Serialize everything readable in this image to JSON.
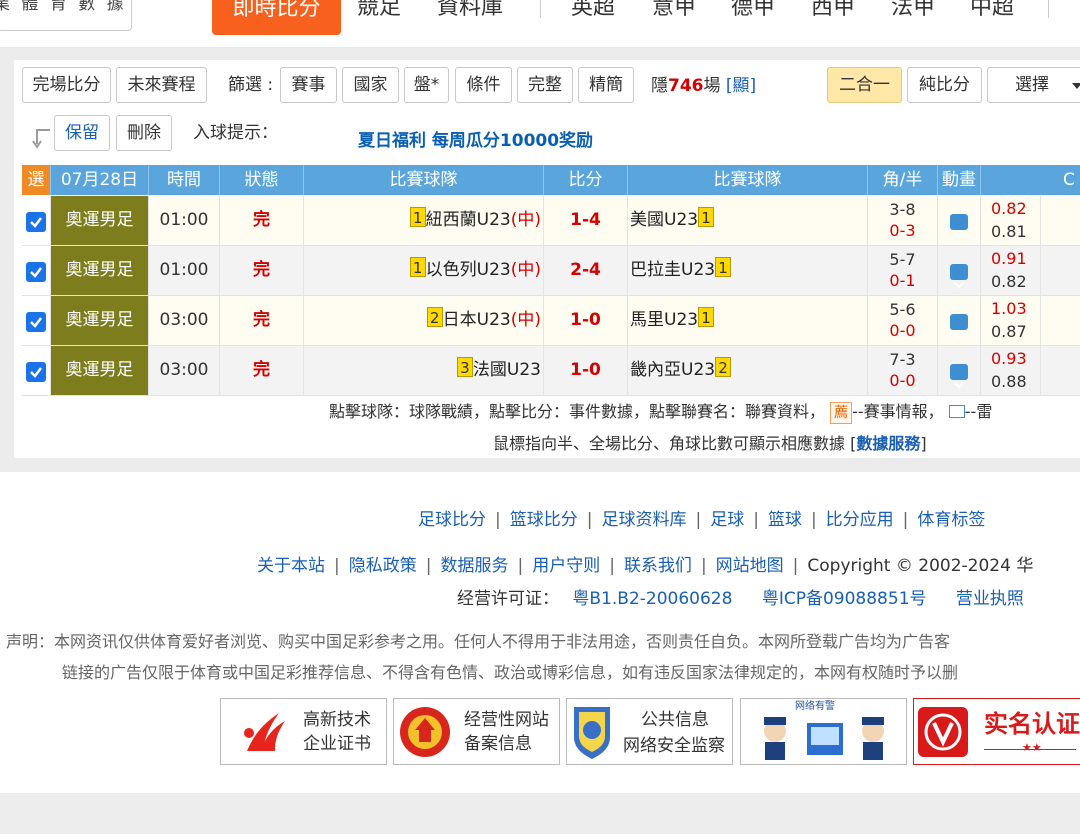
{
  "header": {
    "logo_text": "業 體 育 數 據",
    "nav_active": "即時比分",
    "nav": [
      "競足",
      "資料庫",
      "英超",
      "意甲",
      "德甲",
      "西甲",
      "法甲",
      "中超"
    ]
  },
  "toolbar": {
    "full_score": "完場比分",
    "upcoming": "未來賽程",
    "filter_label": "篩選 :",
    "filters": [
      "賽事",
      "國家",
      "盤*",
      "條件",
      "完整",
      "精簡"
    ],
    "hidden_prefix": "隱",
    "hidden_count": "746",
    "hidden_suffix": "場",
    "show_link": "[顯]",
    "combo": "二合一",
    "pure_score": "純比分",
    "select": "選擇",
    "keep": "保留",
    "delete": "刪除",
    "goal_hint_label": "入球提示：",
    "promo": "夏日福利 每周瓜分10000奖励"
  },
  "table": {
    "headers": {
      "sel": "選",
      "date": "07月28日",
      "time": "時間",
      "status": "狀態",
      "home": "比賽球隊",
      "score": "比分",
      "away": "比賽球隊",
      "corner": "角/半",
      "anim": "動畫",
      "extra": "C"
    },
    "rows": [
      {
        "league": "奧運男足",
        "time": "01:00",
        "status": "完",
        "home_rank": "1",
        "home": "紐西蘭U23",
        "home_neutral": "(中)",
        "score": "1-4",
        "away": "美國U23",
        "away_rank": "1",
        "corner": "3-8",
        "half": "0-3",
        "odds1": "0.82",
        "odds2": "0.81"
      },
      {
        "league": "奧運男足",
        "time": "01:00",
        "status": "完",
        "home_rank": "1",
        "home": "以色列U23",
        "home_neutral": "(中)",
        "score": "2-4",
        "away": "巴拉圭U23",
        "away_rank": "1",
        "corner": "5-7",
        "half": "0-1",
        "odds1": "0.91",
        "odds2": "0.82"
      },
      {
        "league": "奧運男足",
        "time": "03:00",
        "status": "完",
        "home_rank": "2",
        "home": "日本U23",
        "home_neutral": "(中)",
        "score": "1-0",
        "away": "馬里U23",
        "away_rank": "1",
        "corner": "5-6",
        "half": "0-0",
        "odds1": "1.03",
        "odds2": "0.87"
      },
      {
        "league": "奧運男足",
        "time": "03:00",
        "status": "完",
        "home_rank": "3",
        "home": "法國U23",
        "home_neutral": "",
        "score": "1-0",
        "away": "畿內亞U23",
        "away_rank": "2",
        "corner": "7-3",
        "half": "0-0",
        "odds1": "0.93",
        "odds2": "0.88"
      }
    ]
  },
  "notes": {
    "line1_a": "點擊球隊：球隊戰績，點擊比分：事件數據，點擊聯賽名：聯賽資料，",
    "jian": "薦",
    "line1_b": "--賽事情報，",
    "line1_c": "--雷",
    "line2_a": "鼠標指向半、全場比分、角球比數可顯示相應數據 [",
    "line2_link": "數據服務",
    "line2_b": "]"
  },
  "footer": {
    "links1": [
      "足球比分",
      "篮球比分",
      "足球资料库",
      "足球",
      "篮球",
      "比分应用",
      "体育标签"
    ],
    "links2": [
      "关于本站",
      "隐私政策",
      "数据服务",
      "用户守则",
      "联系我们",
      "网站地图"
    ],
    "copyright": "Copyright © 2002-2024 华",
    "license_label": "经营许可证：",
    "license1": "粤B1.B2-20060628",
    "license2": "粤ICP备09088851号",
    "license3": "营业执照",
    "disclaimer1": "声明：本网资讯仅供体育爱好者浏览、购买中国足彩参考之用。任何人不得用于非法用途，否则责任自负。本网所登载广告均为广告客",
    "disclaimer2": "链接的广告仅限于体育或中国足彩推荐信息、不得含有色情、政治或博彩信息，如有违反国家法律规定的，本网有权随时予以删",
    "badges": {
      "b1_l1": "高新技术",
      "b1_l2": "企业证书",
      "b2_l1": "经营性网站",
      "b2_l2": "备案信息",
      "b3_l1": "公共信息",
      "b3_l2": "网络安全监察",
      "b4_top": "网络有警",
      "b5": "实名认证"
    }
  },
  "colors": {
    "accent": "#f8601e",
    "header_blue": "#5aa6dc",
    "league_olive": "#7d7d1e",
    "score_red": "#d40000"
  }
}
